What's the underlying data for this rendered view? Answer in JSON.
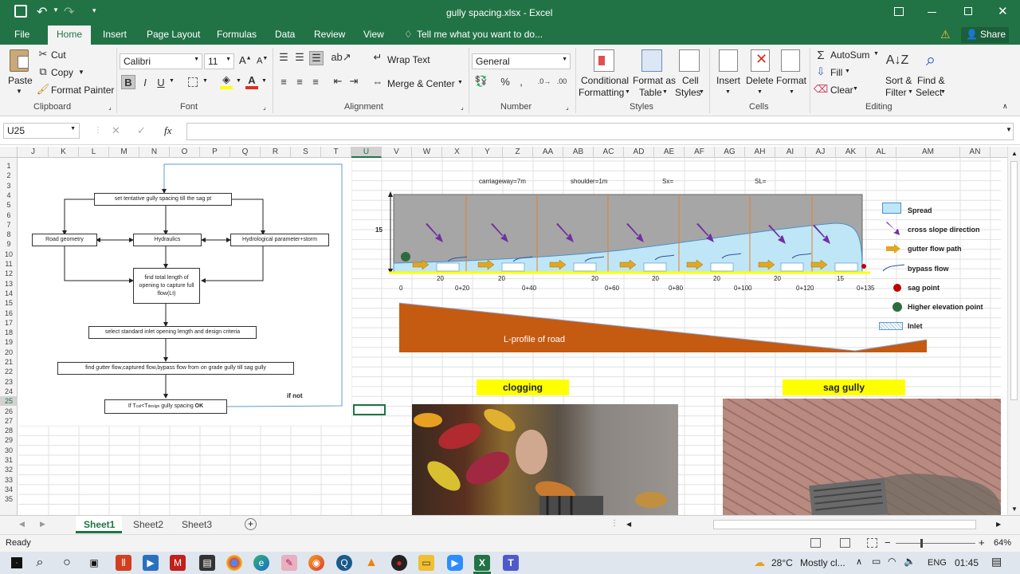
{
  "titlebar": {
    "title": "gully spacing.xlsx - Excel"
  },
  "tabs": [
    "File",
    "Home",
    "Insert",
    "Page Layout",
    "Formulas",
    "Data",
    "Review",
    "View"
  ],
  "tell_me": "Tell me what you want to do...",
  "share": "Share",
  "ribbon": {
    "clipboard": {
      "paste": "Paste",
      "cut": "Cut",
      "copy": "Copy",
      "format_painter": "Format Painter",
      "label": "Clipboard"
    },
    "font": {
      "name": "Calibri",
      "size": "11",
      "bold": "B",
      "italic": "I",
      "underline": "U",
      "label": "Font"
    },
    "alignment": {
      "wrap": "Wrap Text",
      "merge": "Merge & Center",
      "label": "Alignment"
    },
    "number": {
      "format": "General",
      "label": "Number"
    },
    "styles": {
      "cond1": "Conditional",
      "cond2": "Formatting",
      "fmt1": "Format as",
      "fmt2": "Table",
      "cell1": "Cell",
      "cell2": "Styles",
      "label": "Styles"
    },
    "cells": {
      "insert": "Insert",
      "delete": "Delete",
      "format": "Format",
      "label": "Cells"
    },
    "editing": {
      "autosum": "AutoSum",
      "fill": "Fill",
      "clear": "Clear",
      "sort1": "Sort &",
      "sort2": "Filter",
      "find1": "Find &",
      "find2": "Select",
      "label": "Editing"
    }
  },
  "formula_bar": {
    "name_box": "U25",
    "fx": "fx",
    "value": ""
  },
  "columns": [
    "J",
    "K",
    "L",
    "M",
    "N",
    "O",
    "P",
    "Q",
    "R",
    "S",
    "T",
    "U",
    "V",
    "W",
    "X",
    "Y",
    "Z",
    "AA",
    "AB",
    "AC",
    "AD",
    "AE",
    "AF",
    "AG",
    "AH",
    "AI",
    "AJ",
    "AK",
    "AL",
    "AM",
    "AN"
  ],
  "rows": [
    "1",
    "2",
    "3",
    "4",
    "5",
    "6",
    "7",
    "8",
    "9",
    "10",
    "11",
    "12",
    "13",
    "14",
    "15",
    "16",
    "17",
    "18",
    "19",
    "20",
    "21",
    "22",
    "23",
    "24",
    "25",
    "26",
    "27",
    "28",
    "29",
    "30",
    "31",
    "32",
    "33",
    "34",
    "35"
  ],
  "flowchart": {
    "b1": "set  tentative gully spacing till the sag pt",
    "b2": "Road  geometry",
    "b3": "Hydraulics",
    "b4": "Hydrological  parameter+storm",
    "b5": "find total length of opening to capture full flow(Lt)",
    "b6": "select standard inlet opening length and design criteria",
    "b7": "find gutter flow,captured flow,bypass flow from on grade gully till sag gully",
    "b8_pre": "If T",
    "b8_s1": "cal",
    "b8_mid": "<T",
    "b8_s2": "design",
    "b8_post": " gully spacing ",
    "b8_ok": "OK",
    "ifnot": "if not"
  },
  "diagram": {
    "carriageway": "carriageway=7m",
    "shoulder": "shoulder=1m",
    "sx": "Sx=",
    "sl": "SL=",
    "height": "15",
    "spacings": [
      "20",
      "20",
      "20",
      "20",
      "20",
      "20",
      "15"
    ],
    "chainages": [
      "0",
      "0+20",
      "0+40",
      "0+60",
      "0+80",
      "0+100",
      "0+120",
      "0+135"
    ],
    "lprofile": "L-profile of road"
  },
  "legend": [
    "Spread",
    "cross slope direction",
    "gutter flow path",
    "bypass flow",
    "sag point",
    "Higher elevation point",
    "Inlet"
  ],
  "photos": {
    "left": "clogging",
    "right": "sag gully"
  },
  "sheets": [
    "Sheet1",
    "Sheet2",
    "Sheet3"
  ],
  "status": {
    "ready": "Ready",
    "zoom": "64%"
  },
  "taskbar": {
    "temp": "28°C",
    "weather": "Mostly cl...",
    "lang": "ENG",
    "time": "01:45"
  },
  "colors": {
    "excel_green": "#217346",
    "road_grey": "#a6a6a6",
    "spread_blue": "#bfe6f7",
    "profile_orange": "#c55a11",
    "highlight": "#ffff00"
  }
}
